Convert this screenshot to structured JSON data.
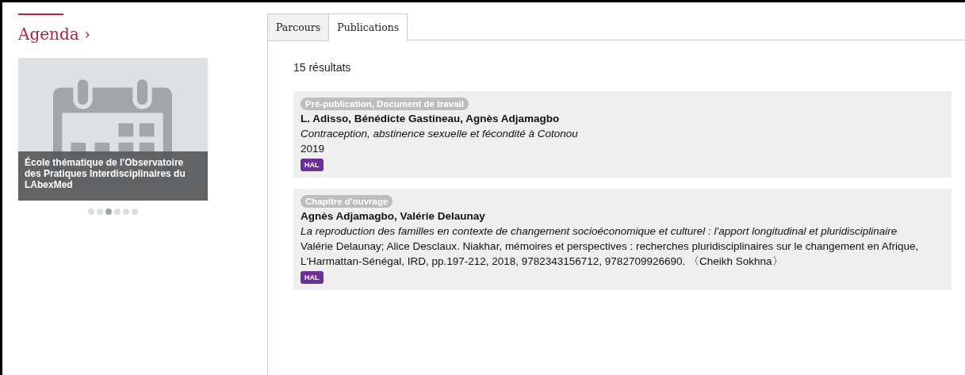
{
  "agenda": {
    "title": "Agenda ›",
    "event": {
      "caption": "École thématique de l'Observatoire des Pratiques Interdisciplinaires du LAbexMed"
    },
    "dots": [
      {
        "selected": false
      },
      {
        "selected": false
      },
      {
        "selected": true
      },
      {
        "selected": false
      },
      {
        "selected": false
      },
      {
        "selected": false
      }
    ]
  },
  "tabs": [
    {
      "label": "Parcours",
      "selected": false
    },
    {
      "label": "Publications",
      "selected": true
    }
  ],
  "results_count": "15 résultats",
  "publications": [
    {
      "type": "Pré-publication, Document de travail",
      "authors": "L. Adisso, Bénédicte Gastineau, Agnès Adjamagbo",
      "title": "Contraception, abstinence sexuelle et fécondité à Cotonou",
      "details": "2019",
      "source": "HAL"
    },
    {
      "type": "Chapitre d'ouvrage",
      "authors": "Agnès Adjamagbo, Valérie Delaunay",
      "title": "La reproduction des familles en contexte de changement socioéconomique et culturel : l'apport longitudinal et pluridisciplinaire",
      "details": "Valérie Delaunay; Alice Desclaux. Niakhar, mémoires et perspectives : recherches pluridisciplinaires sur le changement en Afrique, L'Harmattan-Sénégal, IRD, pp.197-212, 2018, 9782343156712, 9782709926690. 〈Cheikh Sokhna〉",
      "source": "HAL"
    }
  ]
}
